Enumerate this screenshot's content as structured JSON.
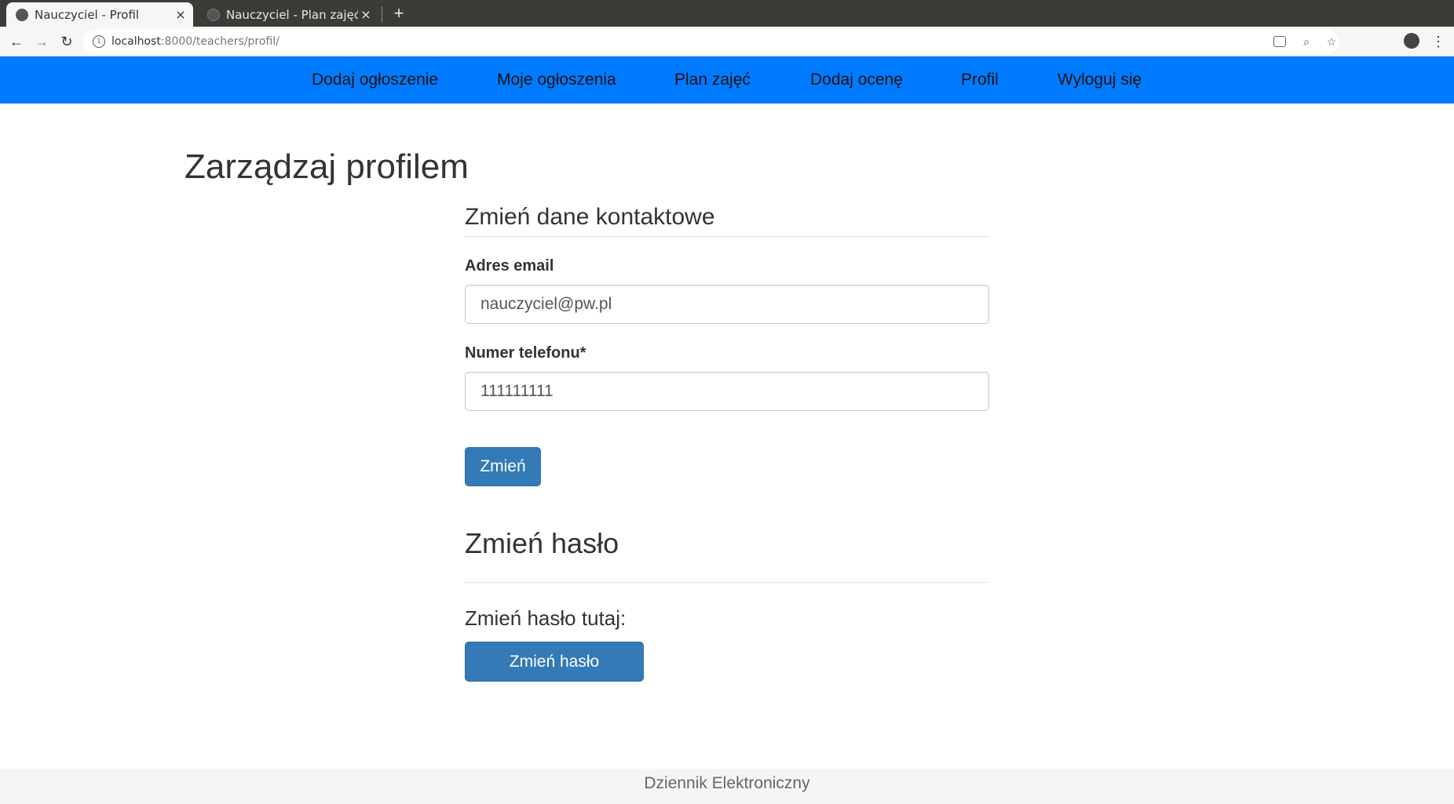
{
  "browser": {
    "tabs": [
      {
        "title": "Nauczyciel - Profil",
        "close": "×"
      },
      {
        "title": "Nauczyciel - Plan zajęć",
        "close": "×"
      }
    ],
    "new_tab": "+",
    "url_host": "localhost",
    "url_rest": ":8000/teachers/profil/",
    "back": "←",
    "forward": "→",
    "reload": "↻",
    "info_glyph": "i",
    "zoom_glyph": "⌕",
    "star_glyph": "☆",
    "menu_glyph": "⋮"
  },
  "nav": {
    "items": [
      "Dodaj ogłoszenie",
      "Moje ogłoszenia",
      "Plan zajęć",
      "Dodaj ocenę",
      "Profil",
      "Wyloguj się"
    ]
  },
  "page": {
    "title": "Zarządzaj profilem"
  },
  "contact": {
    "heading": "Zmień dane kontaktowe",
    "email_label": "Adres email",
    "email_value": "nauczyciel@pw.pl",
    "phone_label": "Numer telefonu*",
    "phone_value": "111111111",
    "submit_label": "Zmień"
  },
  "password": {
    "heading": "Zmień hasło",
    "prompt": "Zmień hasło tutaj:",
    "button_label": "Zmień hasło"
  },
  "footer": {
    "text": "Dziennik Elektroniczny"
  },
  "colors": {
    "navbar": "#007bff",
    "button": "#337ab7"
  }
}
